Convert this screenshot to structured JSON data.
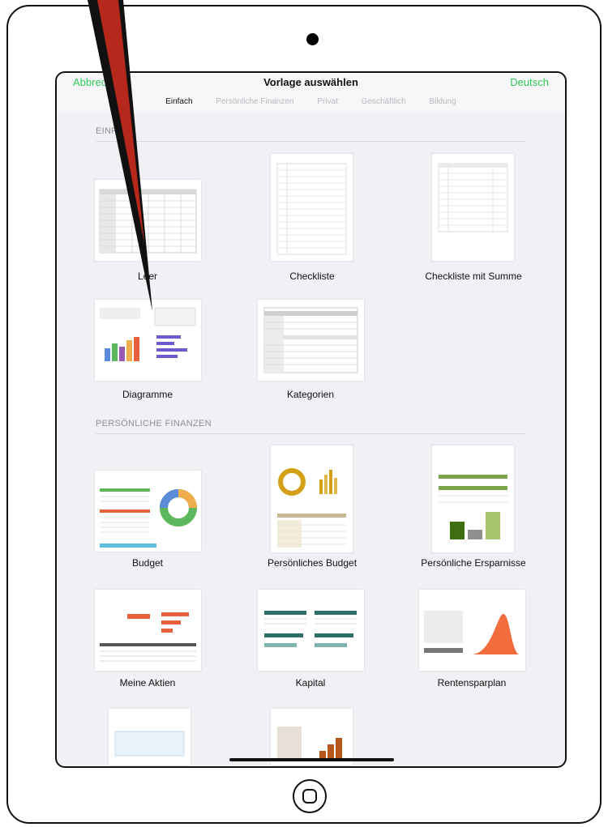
{
  "topbar": {
    "cancel": "Abbrechen",
    "title": "Vorlage auswählen",
    "language": "Deutsch"
  },
  "tabs": [
    "Einfach",
    "Persönliche Finanzen",
    "Privat",
    "Geschäftlich",
    "Bildung"
  ],
  "active_tab": "Einfach",
  "sections": [
    {
      "title": "EINFACH",
      "templates": [
        "Leer",
        "Checkliste",
        "Checkliste mit Summe",
        "Diagramme",
        "Kategorien"
      ]
    },
    {
      "title": "PERSÖNLICHE FINANZEN",
      "templates": [
        "Budget",
        "Persönliches Budget",
        "Persönliche Ersparnisse",
        "Meine Aktien",
        "Kapital",
        "Rentensparplan"
      ]
    }
  ],
  "colors": {
    "accent": "#34c759",
    "background": "#f0f0f5"
  },
  "icons": {
    "home_button": "home-button-icon",
    "annotation": "pen-stroke"
  }
}
